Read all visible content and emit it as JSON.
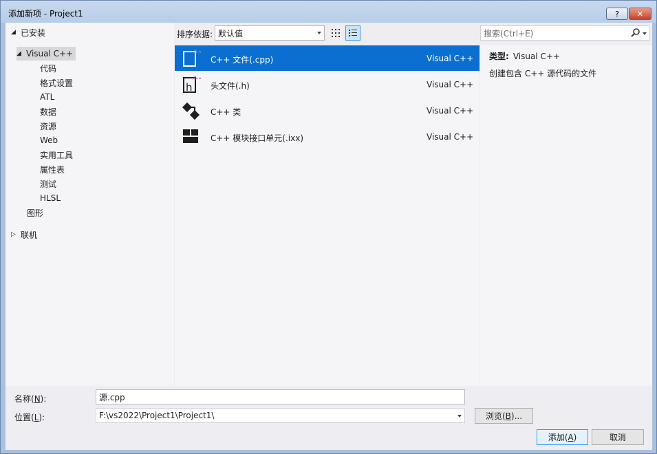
{
  "window": {
    "title": "添加新项 - Project1",
    "help_button": "?",
    "close_button": "✕"
  },
  "tree": {
    "installed": "已安装",
    "visual_cpp": "Visual C++",
    "children": [
      "代码",
      "格式设置",
      "ATL",
      "数据",
      "资源",
      "Web",
      "实用工具",
      "属性表",
      "测试",
      "HLSL"
    ],
    "graphics": "图形",
    "online": "联机"
  },
  "toolbar": {
    "sort_label": "排序依据:",
    "sort_value": "默认值"
  },
  "items": [
    {
      "name": "C++ 文件(.cpp)",
      "type": "Visual C++",
      "icon": "cpp-file-icon"
    },
    {
      "name": "头文件(.h)",
      "type": "Visual C++",
      "icon": "header-file-icon"
    },
    {
      "name": "C++ 类",
      "type": "Visual C++",
      "icon": "cpp-class-icon"
    },
    {
      "name": "C++ 模块接口单元(.ixx)",
      "type": "Visual C++",
      "icon": "module-icon"
    }
  ],
  "search": {
    "placeholder": "搜索(Ctrl+E)"
  },
  "details": {
    "type_label": "类型:",
    "type_value": "Visual C++",
    "description": "创建包含 C++ 源代码的文件"
  },
  "form": {
    "name_label_pre": "名称(",
    "name_label_key": "N",
    "name_label_post": "):",
    "name_value": "源.cpp",
    "location_label_pre": "位置(",
    "location_label_key": "L",
    "location_label_post": "):",
    "location_value": "F:\\vs2022\\Project1\\Project1\\",
    "browse_pre": "浏览(",
    "browse_key": "B",
    "browse_post": ")...",
    "add_pre": "添加(",
    "add_key": "A",
    "add_post": ")",
    "cancel": "取消"
  },
  "colors": {
    "selection": "#0a6fd0",
    "accent_plus": "#a3238e"
  }
}
